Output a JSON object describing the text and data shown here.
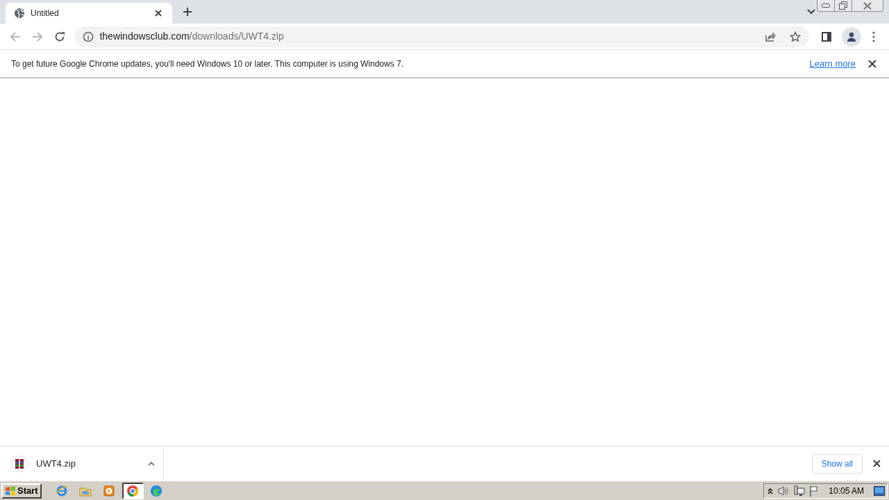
{
  "tabs": [
    {
      "title": "Untitled",
      "selected": true
    }
  ],
  "address": {
    "host": "thewindowsclub.com",
    "path": "/downloads/UWT4.zip"
  },
  "infobar": {
    "message": "To get future Google Chrome updates, you'll need Windows 10 or later. This computer is using Windows 7.",
    "link": "Learn more"
  },
  "downloads": {
    "items": [
      {
        "filename": "UWT4.zip"
      }
    ],
    "show_all": "Show all"
  },
  "taskbar": {
    "start": "Start",
    "apps": [
      {
        "kind": "ie",
        "selected": false
      },
      {
        "kind": "explorer",
        "selected": false
      },
      {
        "kind": "media",
        "selected": false
      },
      {
        "kind": "chrome",
        "selected": true
      },
      {
        "kind": "edge",
        "selected": false
      }
    ],
    "clock": "10:05 AM"
  }
}
